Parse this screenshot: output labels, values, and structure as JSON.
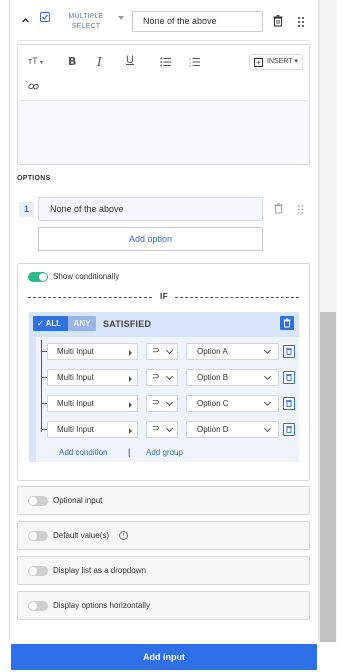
{
  "header": {
    "question_type": "MULTIPLE SELECT",
    "question_text": "None of the above"
  },
  "editor": {
    "toolbar": {
      "text_size_label": "тT",
      "bold_label": "B",
      "italic_label": "I",
      "underline_label": "U",
      "insert_label": "INSERT"
    }
  },
  "options": {
    "section_label": "OPTIONS",
    "items": [
      {
        "number": "1",
        "value": "None of the above"
      }
    ],
    "add_option_label": "Add option"
  },
  "conditional": {
    "show_label": "Show conditionally",
    "enabled": true,
    "if_label": "IF",
    "match_all_label": "ALL",
    "match_any_label": "ANY",
    "satisfied_label": "SATISFIED",
    "conditions": [
      {
        "field": "Multi Input",
        "operator": "⊃",
        "value": "Option A"
      },
      {
        "field": "Multi Input",
        "operator": "⊃",
        "value": "Option B"
      },
      {
        "field": "Multi Input",
        "operator": "⊃",
        "value": "Option C"
      },
      {
        "field": "Multi Input",
        "operator": "⊃",
        "value": "Option D"
      }
    ],
    "add_condition_label": "Add condition",
    "separator": "|",
    "add_group_label": "Add group"
  },
  "settings": [
    {
      "label": "Optional input",
      "enabled": false
    },
    {
      "label": "Default value(s)",
      "enabled": false,
      "info_icon": "info-icon"
    },
    {
      "label": "Display list as a dropdown",
      "enabled": false
    },
    {
      "label": "Display options horizontally",
      "enabled": false
    }
  ],
  "footer": {
    "add_input_label": "Add input"
  },
  "colors": {
    "accent": "#2f6fe8",
    "toggle_on": "#2fb889",
    "group_bg": "#d8e4f8"
  }
}
